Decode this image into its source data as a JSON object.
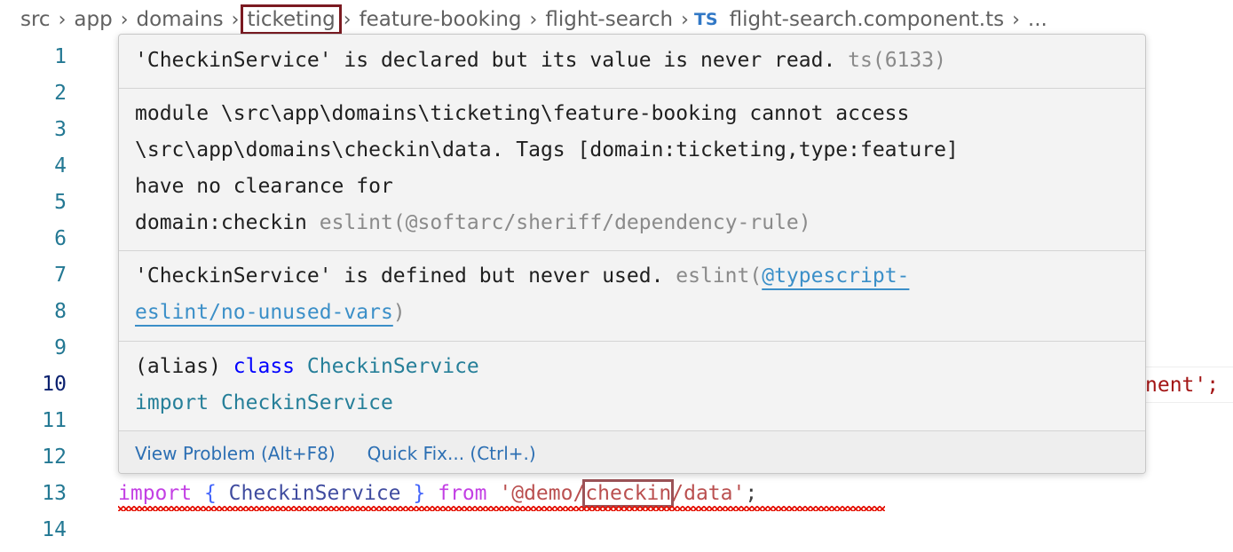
{
  "breadcrumb": {
    "items": [
      "src",
      "app",
      "domains",
      "ticketing",
      "feature-booking",
      "flight-search"
    ],
    "ts_badge": "TS",
    "file": "flight-search.component.ts",
    "more": "..."
  },
  "gutter": {
    "lines": [
      "1",
      "2",
      "3",
      "4",
      "5",
      "6",
      "7",
      "8",
      "9",
      "10",
      "11",
      "12",
      "13",
      "14"
    ],
    "active_line": "10"
  },
  "hover": {
    "problem1": {
      "message": "'CheckinService' is declared but its value is never read.",
      "source": "ts(6133)"
    },
    "problem2": {
      "line1": "module \\src\\app\\domains\\ticketing\\feature-booking cannot access",
      "line2": "\\src\\app\\domains\\checkin\\data. Tags [domain:ticketing,type:feature]",
      "line3": "have no clearance for",
      "line4": "domain:checkin",
      "source": "eslint(@softarc/sheriff/dependency-rule)"
    },
    "problem3": {
      "message": "'CheckinService' is defined but never used.",
      "source_prefix": "eslint(",
      "link_part1": "@typescript-",
      "link_part2": "eslint/no-unused-vars",
      "source_suffix": ")"
    },
    "signature": {
      "alias": "(alias)",
      "class_kw": "class",
      "class_name": "CheckinService",
      "import_kw": "import",
      "import_name": "CheckinService"
    },
    "actions": {
      "view_problem": "View Problem (Alt+F8)",
      "quick_fix": "Quick Fix... (Ctrl+.)"
    }
  },
  "code": {
    "line10_tail": "nent';",
    "line13": {
      "import_kw": "import",
      "open_brace": "{",
      "name": "CheckinService",
      "close_brace": "}",
      "from_kw": "from",
      "str_prefix": "'@demo/",
      "str_highlight": "checkin",
      "str_suffix": "/data'",
      "semi": ";"
    }
  }
}
